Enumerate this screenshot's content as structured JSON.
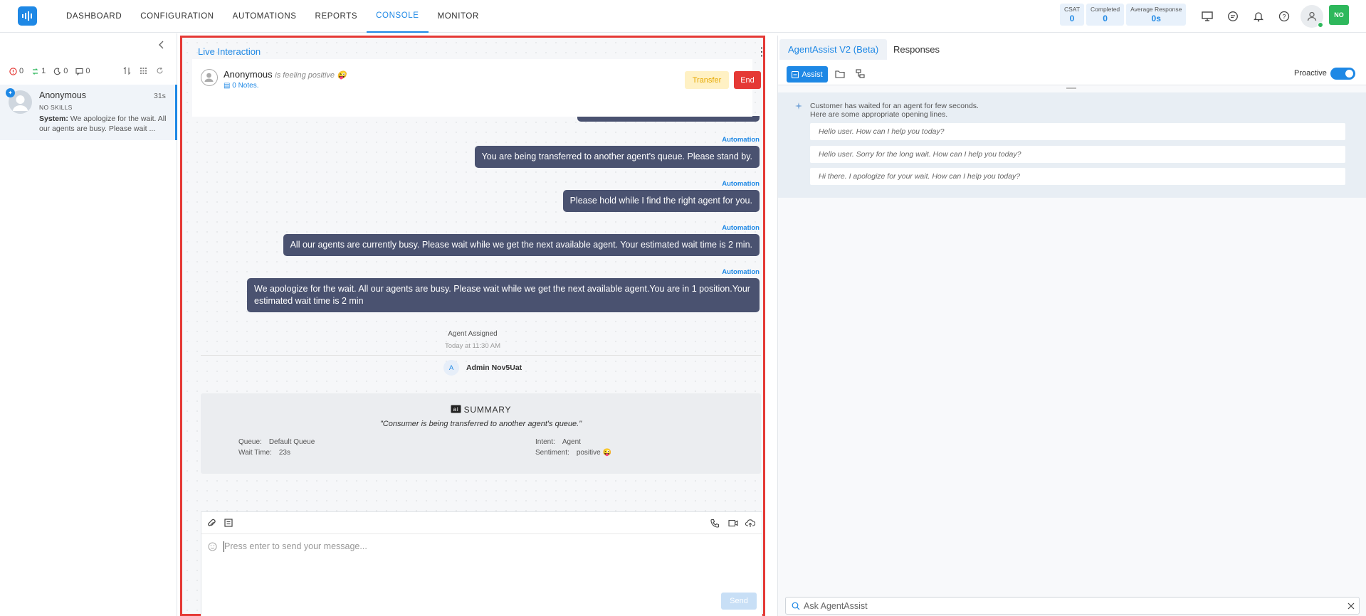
{
  "nav": {
    "items": [
      "DASHBOARD",
      "CONFIGURATION",
      "AUTOMATIONS",
      "REPORTS",
      "CONSOLE",
      "MONITOR"
    ],
    "active": "CONSOLE"
  },
  "stats": [
    {
      "label": "CSAT",
      "value": "0"
    },
    {
      "label": "Completed",
      "value": "0"
    },
    {
      "label": "Average Response",
      "value": "0s"
    }
  ],
  "user_badge": "NO",
  "sidebar": {
    "filters": [
      "0",
      "1",
      "0",
      "0"
    ],
    "conversation": {
      "name": "Anonymous",
      "time": "31s",
      "skill": "NO SKILLS",
      "msg_prefix": "System:",
      "msg": "We apologize for the wait. All our agents are busy. Please wait ..."
    }
  },
  "chat": {
    "title": "Live Interaction",
    "customer_name": "Anonymous",
    "sentiment_text": "is feeling positive 😜",
    "notes": "0 Notes.",
    "transfer_label": "Transfer",
    "end_label": "End",
    "messages": [
      {
        "sender": "Automation",
        "text": "You are being transferred to another agent's queue. Please stand by."
      },
      {
        "sender": "Automation",
        "text": "Please hold while I find the right agent for you."
      },
      {
        "sender": "Automation",
        "text": "All our agents are currently busy. Please wait while we get the next available agent. Your estimated wait time is 2 min."
      },
      {
        "sender": "Automation",
        "text": "We apologize for the wait. All our agents are busy. Please wait while we get the next available agent.You are in 1 position.Your estimated wait time is 2 min"
      }
    ],
    "agent_assigned": "Agent Assigned",
    "agent_assigned_time": "Today at 11:30 AM",
    "agent_initial": "A",
    "agent_name": "Admin Nov5Uat",
    "summary": {
      "title": "SUMMARY",
      "quote": "\"Consumer is being transferred to another agent's queue.\"",
      "queue_label": "Queue:",
      "queue": "Default Queue",
      "wait_label": "Wait Time:",
      "wait": "23s",
      "intent_label": "Intent:",
      "intent": "Agent",
      "sentiment_label": "Sentiment:",
      "sentiment": "positive 😜"
    },
    "composer_placeholder": "Press enter to send your message...",
    "send_label": "Send"
  },
  "assist": {
    "tabs": [
      "AgentAssist V2 (Beta)",
      "Responses"
    ],
    "assist_label": "Assist",
    "proactive_label": "Proactive",
    "proactive_on": true,
    "suggest_head_1": "Customer has waited for an agent for few seconds.",
    "suggest_head_2": "Here are some appropriate opening lines.",
    "suggestions": [
      "Hello user. How can I help you today?",
      "Hello user. Sorry for the long wait. How can I help you today?",
      "Hi there. I apologize for your wait. How can I help you today?"
    ],
    "ask_placeholder": "Ask AgentAssist"
  }
}
